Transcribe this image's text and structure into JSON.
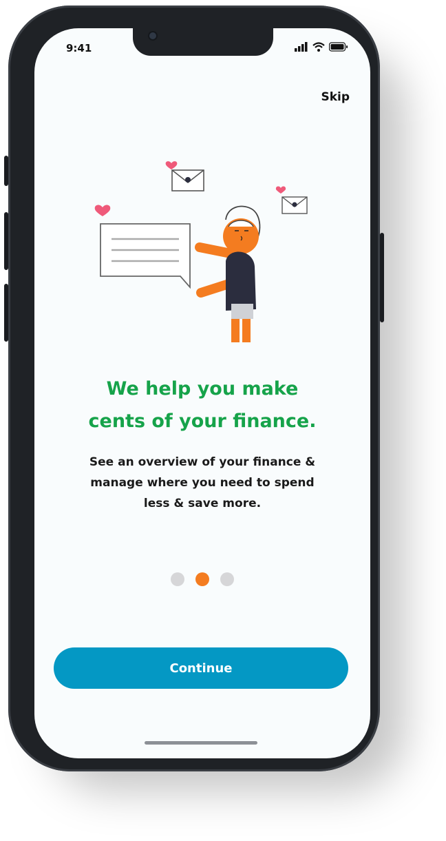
{
  "status_bar": {
    "time": "9:41",
    "icons": [
      "signal-icon",
      "wifi-icon",
      "battery-icon"
    ]
  },
  "header": {
    "skip_label": "Skip"
  },
  "onboarding": {
    "title_line1": "We help you make",
    "title_line2": "cents of your finance.",
    "subtitle_line1": "See an overview of your finance &",
    "subtitle_line2": "manage where you need to spend",
    "subtitle_line3": "less & save more.",
    "pagination": {
      "total": 3,
      "active_index": 1
    },
    "continue_label": "Continue"
  },
  "colors": {
    "accent_green": "#16a34a",
    "accent_orange": "#f47c20",
    "primary_button": "#0498c4",
    "dot_inactive": "#d6d6d8"
  },
  "illustration": {
    "icons": [
      "heart-icon",
      "envelope-icon",
      "chat-bubble-icon",
      "person-illustration"
    ]
  }
}
